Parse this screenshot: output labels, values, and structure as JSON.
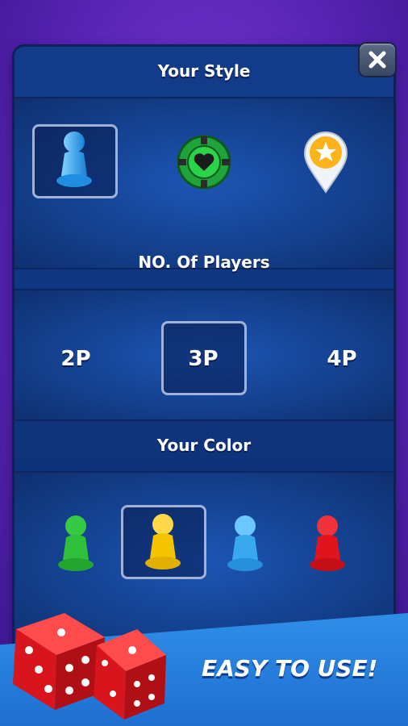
{
  "style_section": {
    "title": "Your Style",
    "options": [
      "pawn-icon",
      "poker-chip-icon",
      "map-pin-star-icon"
    ],
    "selected": 0
  },
  "players_section": {
    "title": "NO. Of Players",
    "options": [
      "2P",
      "3P",
      "4P"
    ],
    "selected": 1
  },
  "color_section": {
    "title": "Your Color",
    "options": [
      {
        "icon": "green-pawn-icon",
        "color": "#2fbf3a"
      },
      {
        "icon": "yellow-pawn-icon",
        "color": "#f5c400"
      },
      {
        "icon": "blue-pawn-icon",
        "color": "#38a8f0"
      },
      {
        "icon": "red-pawn-icon",
        "color": "#e0141c"
      }
    ],
    "selected": 1
  },
  "tagline": "EASY TO USE!",
  "close_icon": "close-icon"
}
